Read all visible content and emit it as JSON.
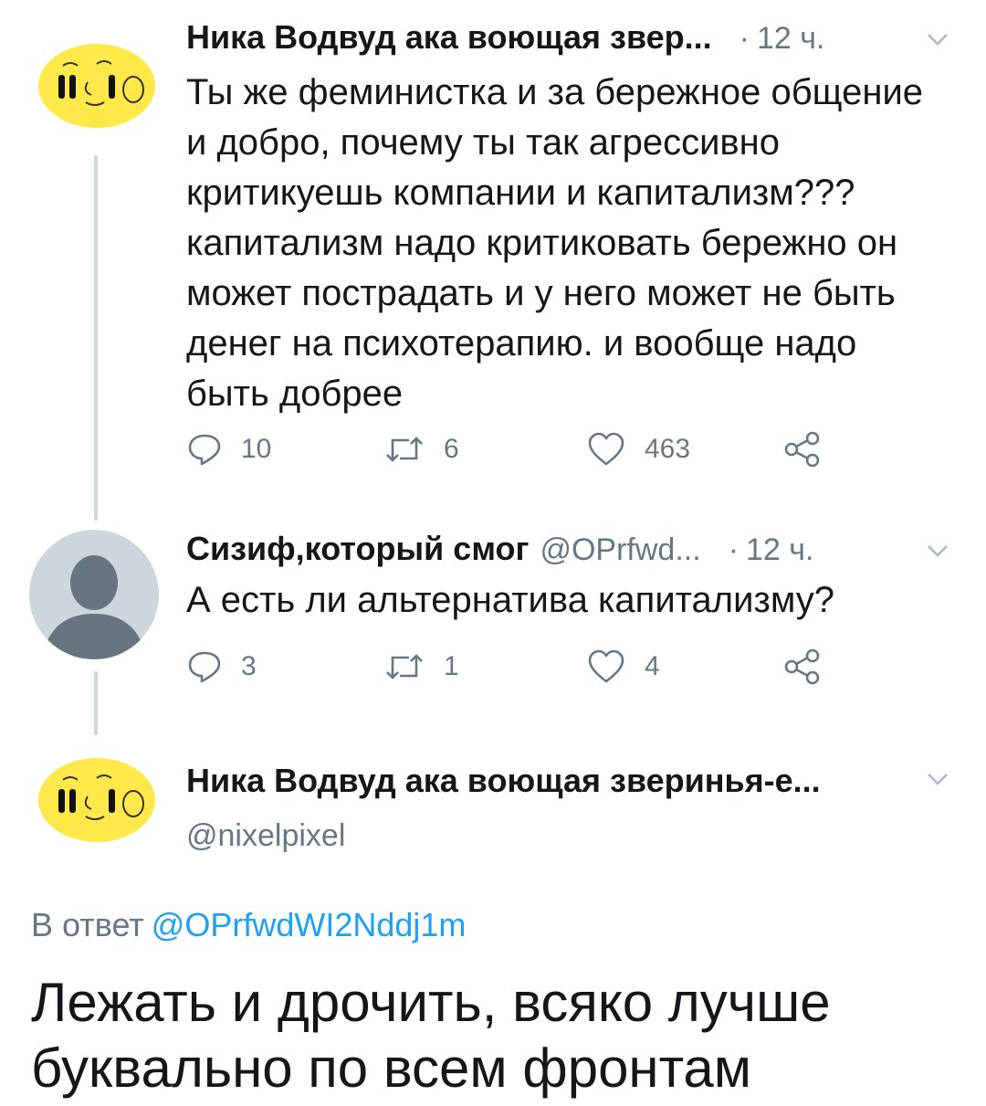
{
  "colors": {
    "text_primary": "#14171a",
    "text_secondary": "#657786",
    "link": "#1da1f2",
    "thread_line": "#ccd6dd",
    "avatar_yellow": "#ffe84a"
  },
  "tweets": [
    {
      "author_name": "Ника Водвуд ака воющая звер...",
      "dot": "·",
      "time": "12 ч.",
      "text": "Ты же феминистка и за бережное общение\nи добро, почему ты так агрессивно\nкритикуешь компании и капитализм???\nкапитализм надо критиковать бережно он\nможет пострадать и у него может не быть\nденег на психотерапию. и вообще надо\nбыть добрее",
      "replies": "10",
      "retweets": "6",
      "likes": "463",
      "avatar_icon": "nika-avatar-icon"
    },
    {
      "author_name": "Сизиф,который смог",
      "handle": "@OPrfwd...",
      "dot": "·",
      "time": "12 ч.",
      "text": "А есть ли альтернатива капитализму?",
      "replies": "3",
      "retweets": "1",
      "likes": "4",
      "avatar_icon": "default-profile-icon"
    }
  ],
  "main_tweet": {
    "author_name": "Ника Водвуд ака воющая зверинья-е...",
    "handle": "@nixelpixel",
    "reply_prefix": "В ответ",
    "reply_mention": "@OPrfwdWI2Nddj1m",
    "text": "Лежать и дрочить, всяко лучше\nбуквально по всем фронтам",
    "avatar_icon": "nika-avatar-icon"
  },
  "icons": [
    "reply-icon",
    "retweet-icon",
    "like-icon",
    "share-icon",
    "chevron-down-icon"
  ]
}
